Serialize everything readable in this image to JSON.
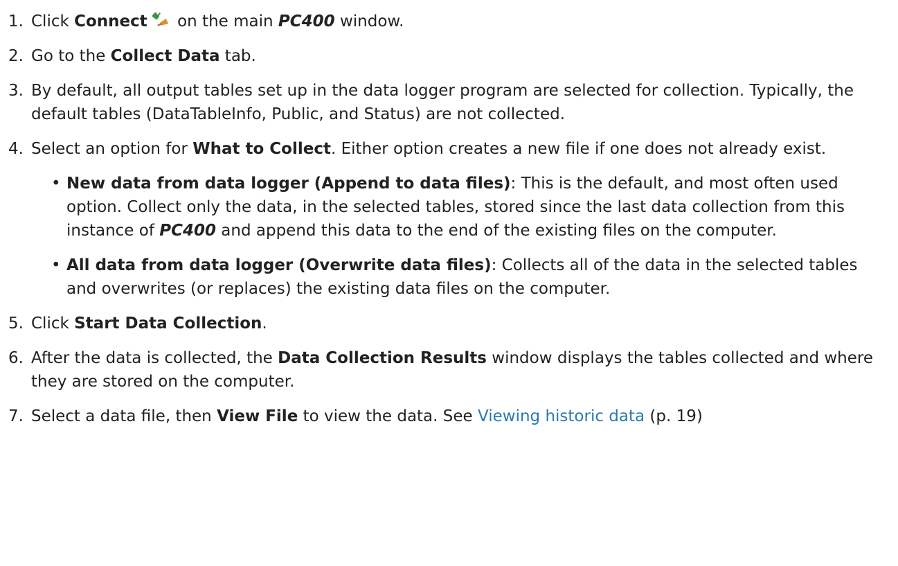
{
  "steps": [
    {
      "num": "1.",
      "parts": [
        {
          "t": "Click "
        },
        {
          "t": "Connect",
          "s": "b"
        },
        {
          "icon": "connect-plug-icon"
        },
        {
          "t": " on the main "
        },
        {
          "t": "PC400",
          "s": "bi"
        },
        {
          "t": " window."
        }
      ]
    },
    {
      "num": "2.",
      "parts": [
        {
          "t": "Go to the "
        },
        {
          "t": "Collect Data",
          "s": "b"
        },
        {
          "t": " tab."
        }
      ]
    },
    {
      "num": "3.",
      "parts": [
        {
          "t": "By default, all output tables set up in the data logger program are selected for collection. Typically, the default tables (DataTableInfo, Public, and Status) are not collected."
        }
      ]
    },
    {
      "num": "4.",
      "parts": [
        {
          "t": "Select an option for "
        },
        {
          "t": "What to Collect",
          "s": "b"
        },
        {
          "t": ". Either option creates a new file if one does not already exist."
        }
      ],
      "bullets": [
        {
          "dot": "•",
          "parts": [
            {
              "t": "New data from data logger (Append to data files)",
              "s": "b"
            },
            {
              "t": ": This is the default, and most often used option. Collect only the data, in the selected tables, stored since the last data collection from this instance of "
            },
            {
              "t": "PC400",
              "s": "bi"
            },
            {
              "t": " and append this data to the end of the existing files on the computer."
            }
          ]
        },
        {
          "dot": "•",
          "parts": [
            {
              "t": "All data from data logger (Overwrite data files)",
              "s": "b"
            },
            {
              "t": ": Collects all of the data in the selected tables and overwrites (or replaces) the existing data files on the computer."
            }
          ]
        }
      ]
    },
    {
      "num": "5.",
      "parts": [
        {
          "t": "Click "
        },
        {
          "t": "Start Data Collection",
          "s": "b"
        },
        {
          "t": "."
        }
      ]
    },
    {
      "num": "6.",
      "parts": [
        {
          "t": "After the data is collected, the "
        },
        {
          "t": "Data Collection Results",
          "s": "b"
        },
        {
          "t": " window displays the tables collected and where they are stored on the computer."
        }
      ]
    },
    {
      "num": "7.",
      "parts": [
        {
          "t": "Select a data file, then "
        },
        {
          "t": "View File",
          "s": "b"
        },
        {
          "t": " to view the data. See "
        },
        {
          "t": "Viewing historic data",
          "s": "link"
        },
        {
          "t": " (p. 19)"
        }
      ]
    }
  ],
  "colors": {
    "text": "#222222",
    "link": "#2a7ab0",
    "icon_green": "#2f9e3a",
    "icon_orange": "#d9902a"
  }
}
